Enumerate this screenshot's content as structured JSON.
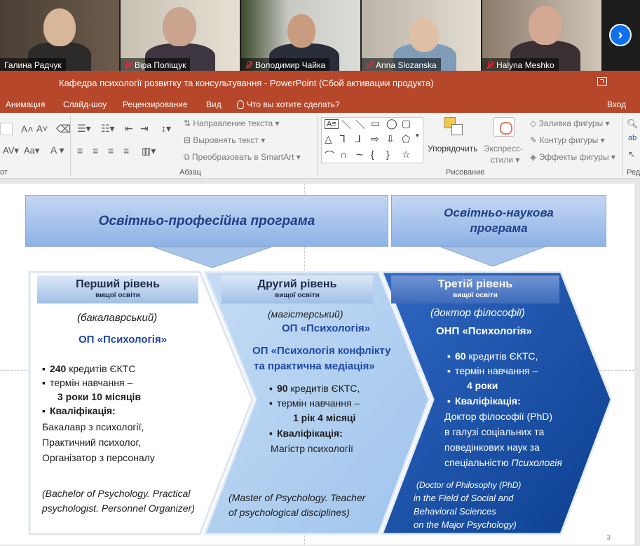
{
  "participants": [
    {
      "name": "Галина Радчук",
      "muted": false
    },
    {
      "name": "Віра Поліщук",
      "muted": true
    },
    {
      "name": "Володимир Чайка",
      "muted": true
    },
    {
      "name": "Anna Slozanska",
      "muted": true
    },
    {
      "name": "Halyna Meshko",
      "muted": true
    }
  ],
  "next_icon": "chevron-right-icon",
  "window": {
    "title": "Кафедра психології розвитку та консультування  -  PowerPoint (Сбой активации продукта)",
    "signin": "Вход"
  },
  "menu": {
    "tabs": [
      "Анимация",
      "Слайд-шоу",
      "Рецензирование",
      "Вид"
    ],
    "tell_me": "Что вы хотите сделать?"
  },
  "ribbon": {
    "paragraph": {
      "text_direction": "Направление текста",
      "align_text": "Выровнять текст",
      "smartart": "Преобразовать в SmartArt",
      "label": "Абзац"
    },
    "drawing": {
      "arrange": "Упорядочить",
      "quick_styles_1": "Экспресс-",
      "quick_styles_2": "стили",
      "fill": "Заливка фигуры",
      "outline": "Контур фигуры",
      "effects": "Эффекты фигуры",
      "label": "Рисование"
    },
    "left_label": "от",
    "right_label": "Ред"
  },
  "slide": {
    "number": "3",
    "header_left": "Освітньо-професійна програма",
    "header_right_1": "Освітньо-наукова",
    "header_right_2": "програма",
    "level1": {
      "title": "Перший рівень",
      "subtitle": "вищої освіти",
      "degree": "(бакалаврський)",
      "program": "ОП «Психологія»",
      "credits_num": "240",
      "credits": " кредитів ЄКТС",
      "term": "термін навчання –",
      "term_value": "3 роки 10 місяців",
      "qual": "Кваліфікація:",
      "q1": "Бакалавр з психології,",
      "q2": "Практичний психолог,",
      "q3": "Організатор з персоналу",
      "en1": "(Bachelor of Psychology. Practical",
      "en2": "psychologist. Personnel Organizer)"
    },
    "level2": {
      "title": "Другий рівень",
      "subtitle": "вищої освіти",
      "degree": "(магістерський)",
      "program1": "ОП «Психологія»",
      "program2a": "ОП «Психологія конфлікту",
      "program2b": "та практична медіація»",
      "credits_num": "90",
      "credits": " кредитів ЄКТС,",
      "term": "термін навчання –",
      "term_value": "1 рік 4 місяці",
      "qual": "Кваліфікація:",
      "q1": "Магістр психології",
      "en1": "(Master of Psychology. Teacher",
      "en2": "of psychological disciplines)"
    },
    "level3": {
      "title": "Третій рівень",
      "subtitle": "вищої освіти",
      "degree": "(доктор філософії)",
      "program": "ОНП «Психологія»",
      "credits_num": "60",
      "credits": " кредитів ЄКТС,",
      "term": "термін навчання –",
      "term_value": "4 роки",
      "qual": "Кваліфікація:",
      "q1": "Доктор філософії (PhD)",
      "q2": "в галузі соціальних та",
      "q3": "поведінкових наук за",
      "q4a": "спеціальністю ",
      "q4b": "Психологія",
      "en1": "(Doctor of Philosophy (PhD)",
      "en2": "in the Field of Social and",
      "en3": "Behavioral Sciences",
      "en4": "on the Major Psychology)"
    }
  }
}
